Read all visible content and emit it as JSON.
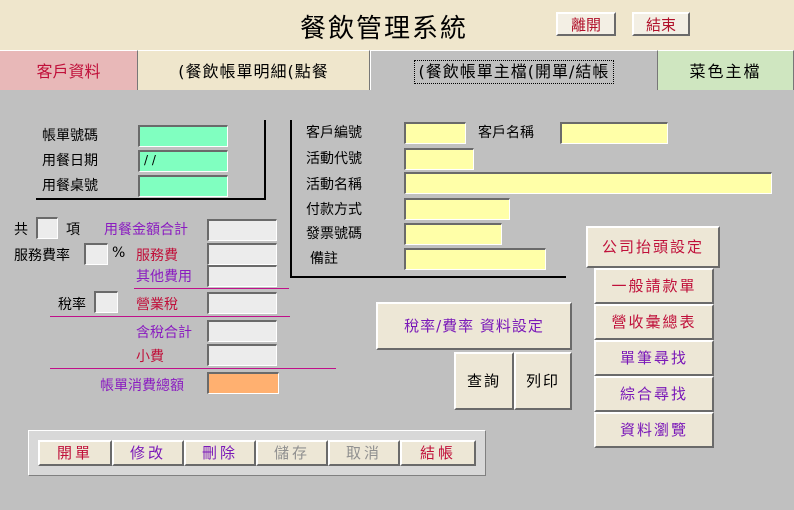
{
  "app": {
    "title": "餐飲管理系統",
    "leave_label": "離開",
    "end_label": "結束"
  },
  "tabs": [
    {
      "label": "客戶資料",
      "color": "#e8b8b8"
    },
    {
      "label": "(餐飲帳單明細(點餐",
      "color": "#efe6cc"
    },
    {
      "label": "(餐飲帳單主檔(開單/結帳",
      "color": "#c0c0c0"
    },
    {
      "label": "菜色主檔",
      "color": "#cfe6c0"
    }
  ],
  "bill": {
    "number_label": "帳單號碼",
    "number_value": "",
    "date_label": "用餐日期",
    "date_value": "  /  /",
    "table_label": "用餐桌號",
    "table_value": ""
  },
  "customer": {
    "code_label": "客戶編號",
    "code_value": "",
    "name_label": "客戶名稱",
    "name_value": "",
    "event_code_label": "活動代號",
    "event_code_value": "",
    "event_name_label": "活動名稱",
    "event_name_value": "",
    "payment_label": "付款方式",
    "payment_value": "",
    "invoice_label": "發票號碼",
    "invoice_value": "",
    "remark_label": "備註",
    "remark_value": ""
  },
  "totals": {
    "total_prefix": "共",
    "items_suffix": "項",
    "items_value": "",
    "meal_total_label": "用餐金額合計",
    "meal_total_value": "",
    "service_rate_label": "服務費率",
    "service_rate_value": "",
    "percent_sign": "%",
    "service_fee_label": "服務費",
    "service_fee_value": "",
    "other_fee_label": "其他費用",
    "other_fee_value": "",
    "tax_rate_label": "稅率",
    "tax_rate_value": "",
    "business_tax_label": "營業稅",
    "business_tax_value": "",
    "tax_included_label": "含稅合計",
    "tax_included_value": "",
    "tip_label": "小費",
    "tip_value": "",
    "grand_total_label": "帳單消費總額",
    "grand_total_value": ""
  },
  "actions": {
    "tax_settings_label": "稅率/費率 資料設定",
    "query_label": "查詢",
    "print_label": "列印"
  },
  "side_buttons": [
    "公司抬頭設定",
    "一般請款單",
    "營收彙總表",
    "單筆尋找",
    "綜合尋找",
    "資料瀏覽"
  ],
  "toolbar": [
    {
      "label": "開單",
      "enabled": true
    },
    {
      "label": "修改",
      "enabled": true
    },
    {
      "label": "刪除",
      "enabled": true
    },
    {
      "label": "儲存",
      "enabled": false
    },
    {
      "label": "取消",
      "enabled": false
    },
    {
      "label": "結帳",
      "enabled": true
    }
  ]
}
